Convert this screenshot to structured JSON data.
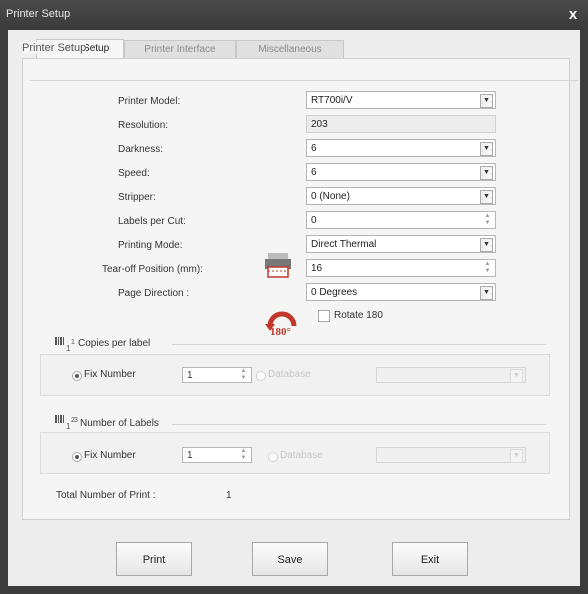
{
  "window": {
    "title": "Printer Setup",
    "close_glyph": "x"
  },
  "tabs": [
    {
      "label": "Printer Setup",
      "active": true
    },
    {
      "label": "Printer Interface",
      "active": false
    },
    {
      "label": "Miscellaneous",
      "active": false
    }
  ],
  "group": {
    "label": "Printer Setup"
  },
  "fields": {
    "printer_model": {
      "label": "Printer Model:",
      "value": "RT700i/V"
    },
    "resolution": {
      "label": "Resolution:",
      "value": "203"
    },
    "darkness": {
      "label": "Darkness:",
      "value": "6"
    },
    "speed": {
      "label": "Speed:",
      "value": "6"
    },
    "stripper": {
      "label": "Stripper:",
      "value": "0 (None)"
    },
    "labels_per_cut": {
      "label": "Labels per Cut:",
      "value": "0"
    },
    "printing_mode": {
      "label": "Printing Mode:",
      "value": "Direct Thermal"
    },
    "tear_off": {
      "label": "Tear-off Position  (mm):",
      "value": "16"
    },
    "page_direction": {
      "label": "Page Direction :",
      "value": "0 Degrees"
    }
  },
  "rotate": {
    "label": "Rotate 180",
    "badge": "180°",
    "checked": false
  },
  "copies": {
    "title": "Copies per label",
    "fix_label": "Fix Number",
    "fix_value": "1",
    "db_label": "Database"
  },
  "labels": {
    "title": "Number of Labels",
    "fix_label": "Fix Number",
    "fix_value": "1",
    "db_label": "Database"
  },
  "total": {
    "label": "Total Number of Print :",
    "value": "1"
  },
  "buttons": {
    "print": "Print",
    "save": "Save",
    "exit": "Exit"
  },
  "icons": {
    "dropdown": "chevron-down-icon",
    "spinner": "spinner-arrows-icon",
    "tearoff": "printer-tearoff-icon",
    "rotate": "rotate-180-icon",
    "copies": "barcode-copies-icon",
    "labels": "barcode-labels-icon"
  },
  "colors": {
    "titlebar": "#3c3c3c",
    "rotate_red": "#c0392b"
  }
}
